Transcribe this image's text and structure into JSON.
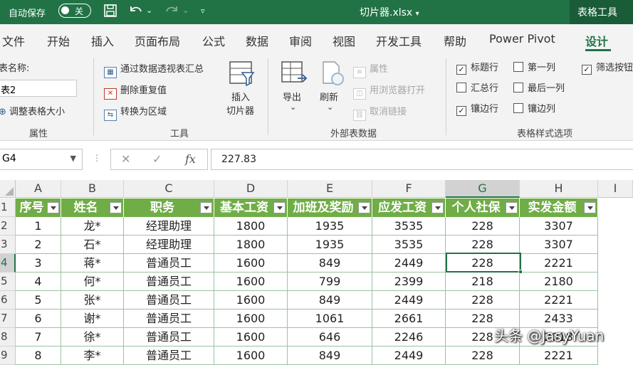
{
  "titlebar": {
    "autosave_label": "自动保存",
    "autosave_state": "关",
    "filename": "切片器.xlsx",
    "context_tab": "表格工具"
  },
  "menu": [
    "文件",
    "开始",
    "插入",
    "页面布局",
    "公式",
    "数据",
    "审阅",
    "视图",
    "开发工具",
    "帮助",
    "Power Pivot",
    "设计"
  ],
  "active_menu": "设计",
  "ribbon": {
    "table_name_label": "表名称:",
    "table_name_value": "表2",
    "resize_table": "调整表格大小",
    "group_props": "属性",
    "summarize_pivot": "通过数据透视表汇总",
    "remove_duplicates": "删除重复值",
    "convert_range": "转换为区域",
    "insert_slicer_1": "插入",
    "insert_slicer_2": "切片器",
    "group_tools": "工具",
    "export": "导出",
    "refresh": "刷新",
    "properties": "属性",
    "open_browser": "用浏览器打开",
    "unlink": "取消链接",
    "group_external": "外部表数据",
    "opt_header_row": "标题行",
    "opt_first_col": "第一列",
    "opt_filter_btn": "筛选按钮",
    "opt_total_row": "汇总行",
    "opt_last_col": "最后一列",
    "opt_banded_rows": "镶边行",
    "opt_banded_cols": "镶边列",
    "group_style_opts": "表格样式选项"
  },
  "formula": {
    "namebox": "G4",
    "value": "227.83"
  },
  "columns": [
    "A",
    "B",
    "C",
    "D",
    "E",
    "F",
    "G",
    "H",
    "I"
  ],
  "rows": [
    "1",
    "2",
    "3",
    "4",
    "5",
    "6",
    "7",
    "8",
    "9"
  ],
  "headers": [
    "序号",
    "姓名",
    "职务",
    "基本工资",
    "加班及奖励",
    "应发工资",
    "个人社保",
    "实发金额"
  ],
  "data": [
    [
      "1",
      "龙*",
      "经理助理",
      "1800",
      "1935",
      "3535",
      "228",
      "3307"
    ],
    [
      "2",
      "石*",
      "经理助理",
      "1800",
      "1935",
      "3535",
      "228",
      "3307"
    ],
    [
      "3",
      "蒋*",
      "普通员工",
      "1600",
      "849",
      "2449",
      "228",
      "2221"
    ],
    [
      "4",
      "何*",
      "普通员工",
      "1600",
      "799",
      "2399",
      "218",
      "2180"
    ],
    [
      "5",
      "张*",
      "普通员工",
      "1600",
      "849",
      "2449",
      "228",
      "2221"
    ],
    [
      "6",
      "谢*",
      "普通员工",
      "1600",
      "1061",
      "2661",
      "228",
      "2433"
    ],
    [
      "7",
      "徐*",
      "普通员工",
      "1600",
      "646",
      "2246",
      "228",
      "2018"
    ],
    [
      "8",
      "李*",
      "普通员工",
      "1600",
      "849",
      "2449",
      "228",
      "2221"
    ]
  ],
  "watermark": "头条 @JasyYuan"
}
